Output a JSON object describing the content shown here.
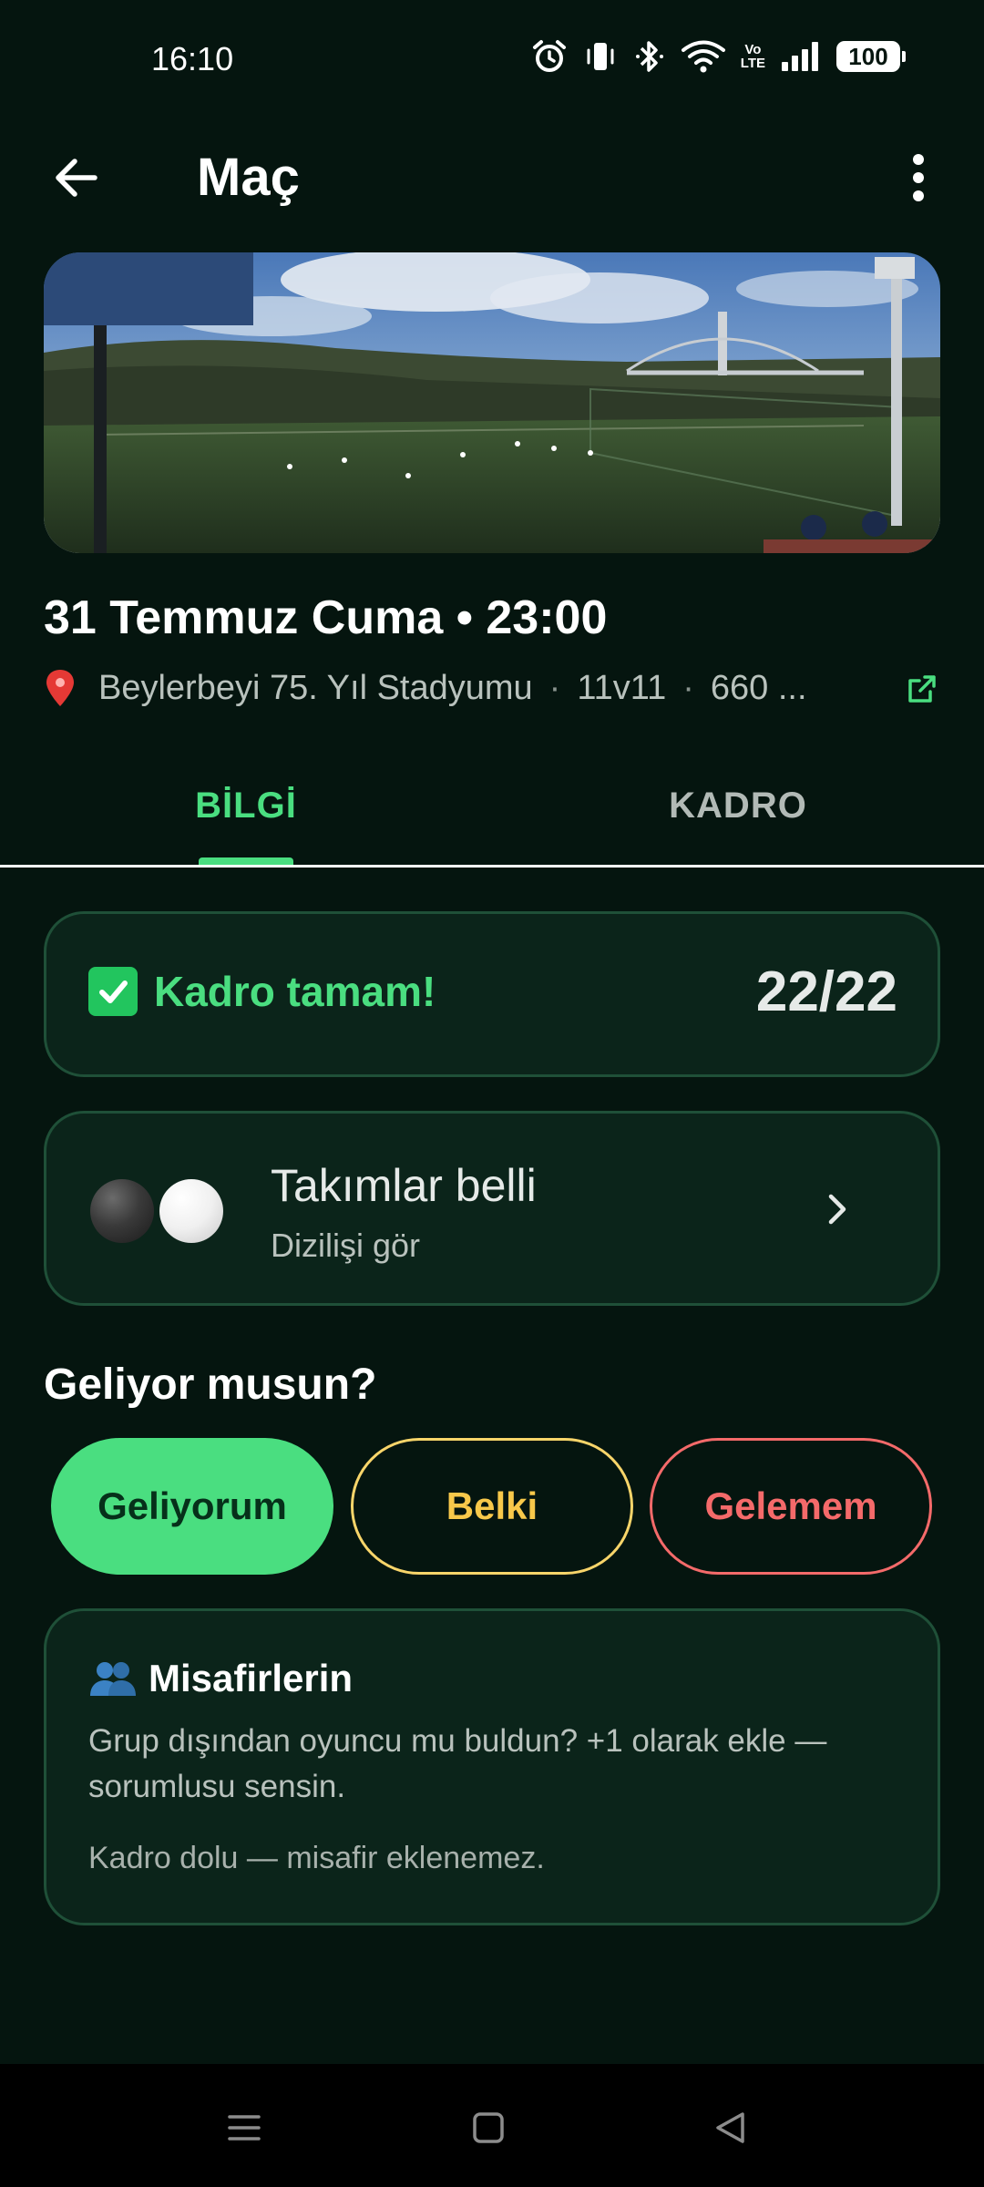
{
  "status_bar": {
    "time": "16:10",
    "battery": "100",
    "icons": [
      "alarm-icon",
      "vibrate-icon",
      "bluetooth-icon",
      "wifi-icon",
      "volte-icon",
      "signal-icon",
      "battery-icon"
    ],
    "volte_top": "Vo",
    "volte_bottom": "LTE"
  },
  "app_bar": {
    "title": "Maç",
    "back_icon": "arrow-left-icon",
    "more_icon": "more-vertical-icon"
  },
  "match": {
    "date_time": "31 Temmuz Cuma • 23:00",
    "venue": "Beylerbeyi 75. Yıl Stadyumu",
    "format": "11v11",
    "price": "660 ...",
    "separator": "·"
  },
  "tabs": [
    {
      "label": "BİLGİ",
      "active": true
    },
    {
      "label": "KADRO",
      "active": false
    }
  ],
  "squad": {
    "status": "Kadro tamam!",
    "count": "22/22"
  },
  "teams": {
    "title": "Takımlar belli",
    "subtitle": "Dizilişi gör"
  },
  "rsvp": {
    "question": "Geliyor musun?",
    "yes": "Geliyorum",
    "maybe": "Belki",
    "no": "Gelemem",
    "selected": "yes"
  },
  "guests": {
    "title": "Misafirlerin",
    "description": "Grup dışından oyuncu mu buldun? +1 olarak ekle — sorumlusu sensin.",
    "note": "Kadro dolu — misafir eklenemez."
  },
  "colors": {
    "background": "#05150f",
    "accent_green": "#4ade80",
    "maybe_yellow": "#f8c84a",
    "no_red": "#f46a6a",
    "card_bg": "#0b241a",
    "card_border": "#1f5038"
  }
}
